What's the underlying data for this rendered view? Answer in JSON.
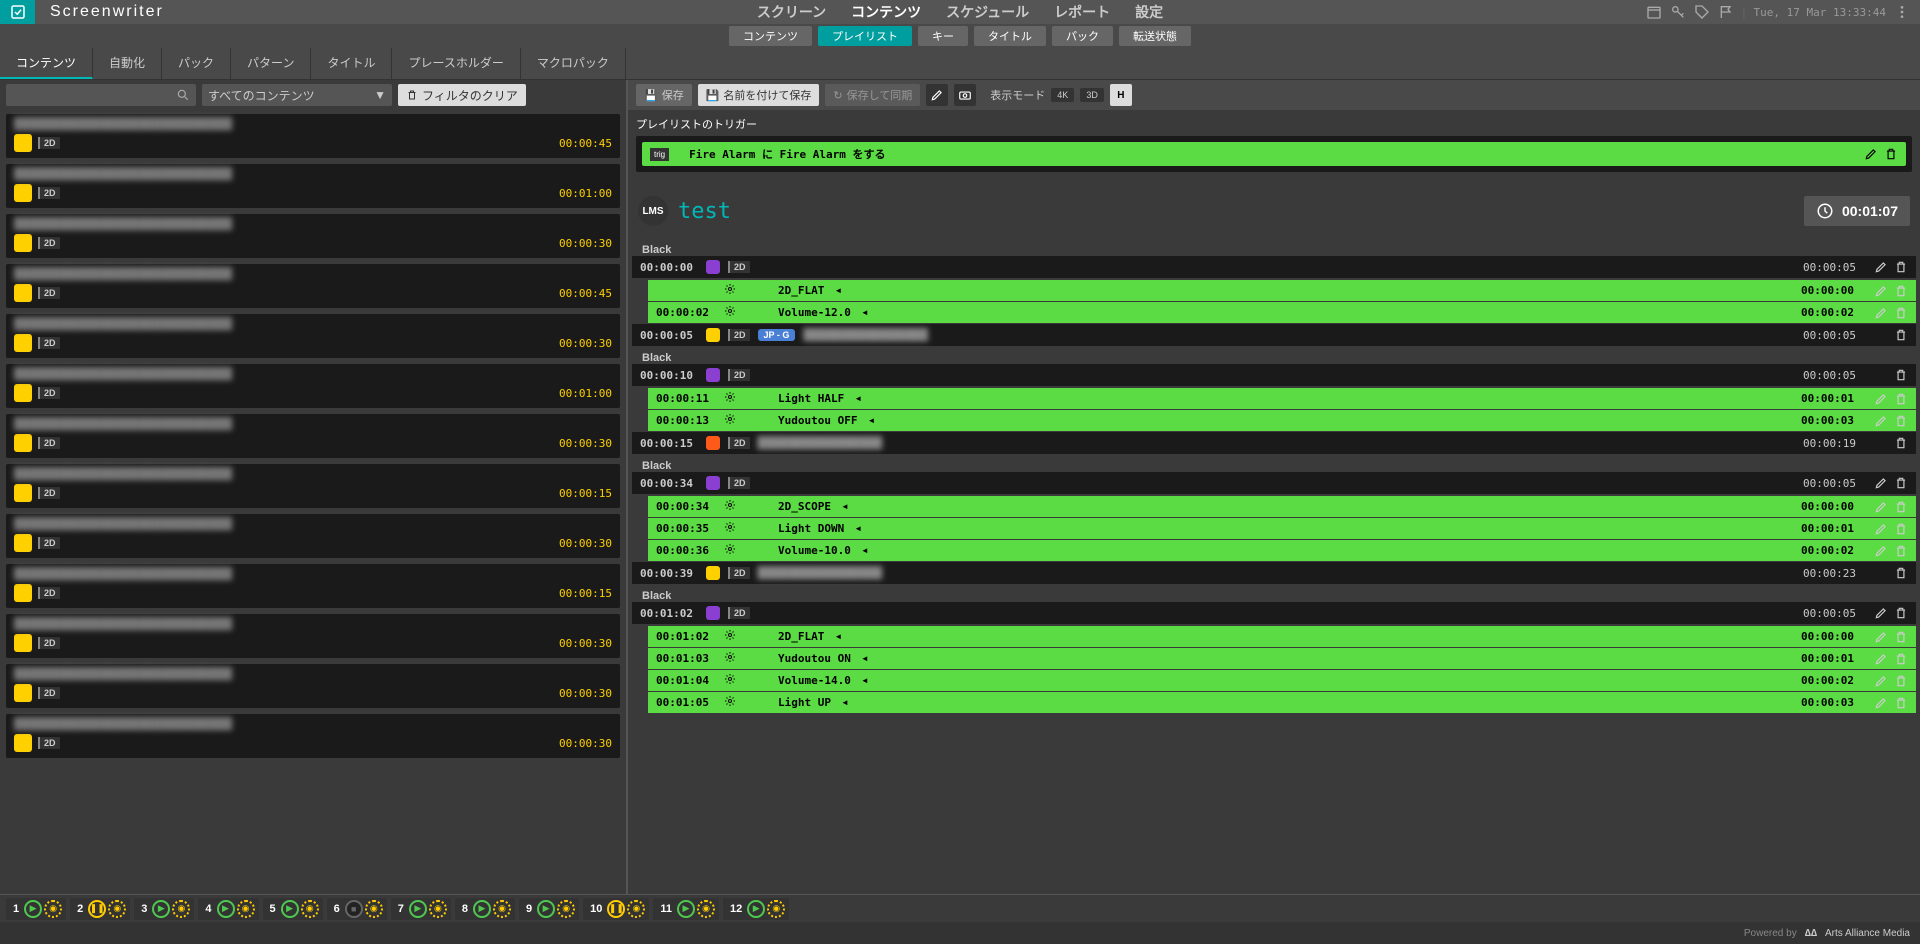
{
  "app": {
    "title": "Screenwriter"
  },
  "datetime": "Tue, 17 Mar 13:33:44",
  "top_nav": {
    "items": [
      "スクリーン",
      "コンテンツ",
      "スケジュール",
      "レポート",
      "設定"
    ],
    "active": 1
  },
  "sub_nav": {
    "items": [
      "コンテンツ",
      "プレイリスト",
      "キー",
      "タイトル",
      "パック",
      "転送状態"
    ],
    "active": 1
  },
  "left_tabs": {
    "items": [
      "コンテンツ",
      "自動化",
      "パック",
      "パターン",
      "タイトル",
      "プレースホルダー",
      "マクロパック"
    ],
    "active": 0
  },
  "filter": {
    "search_placeholder": "",
    "dropdown": "すべてのコンテンツ",
    "clear": "フィルタのクリア"
  },
  "content_list": [
    {
      "badge": "2D",
      "duration": "00:00:45"
    },
    {
      "badge": "2D",
      "duration": "00:01:00"
    },
    {
      "badge": "2D",
      "duration": "00:00:30"
    },
    {
      "badge": "2D",
      "duration": "00:00:45"
    },
    {
      "badge": "2D",
      "duration": "00:00:30"
    },
    {
      "badge": "2D",
      "duration": "00:01:00"
    },
    {
      "badge": "2D",
      "duration": "00:00:30"
    },
    {
      "badge": "2D",
      "duration": "00:00:15"
    },
    {
      "badge": "2D",
      "duration": "00:00:30"
    },
    {
      "badge": "2D",
      "duration": "00:00:15"
    },
    {
      "badge": "2D",
      "duration": "00:00:30"
    },
    {
      "badge": "2D",
      "duration": "00:00:30"
    },
    {
      "badge": "2D",
      "duration": "00:00:30"
    }
  ],
  "toolbar": {
    "save": "保存",
    "save_as": "名前を付けて保存",
    "save_sync": "保存して同期",
    "display_mode": "表示モード",
    "pill_4k": "4K",
    "pill_3d": "3D"
  },
  "trigger": {
    "header": "プレイリストのトリガー",
    "badge": "trig",
    "text": "Fire Alarm に Fire Alarm をする"
  },
  "playlist": {
    "badge": "LMS",
    "title": "test",
    "total": "00:01:07",
    "rows": [
      {
        "type": "label",
        "text": "Black"
      },
      {
        "type": "clip",
        "time": "00:00:00",
        "box": "purple",
        "tag": "2D",
        "dur": "00:00:05",
        "edit": true
      },
      {
        "type": "cue",
        "time": "",
        "label": "2D_FLAT",
        "dur": "00:00:00"
      },
      {
        "type": "cue",
        "time": "00:00:02",
        "label": "Volume-12.0",
        "dur": "00:00:02"
      },
      {
        "type": "clip",
        "time": "00:00:05",
        "box": "yellow",
        "tag": "2D",
        "jp": "JP - G",
        "dur": "00:00:05",
        "blurred": true
      },
      {
        "type": "label",
        "text": "Black"
      },
      {
        "type": "clip",
        "time": "00:00:10",
        "box": "purple",
        "tag": "2D",
        "dur": "00:00:05"
      },
      {
        "type": "cue",
        "time": "00:00:11",
        "label": "Light HALF",
        "dur": "00:00:01"
      },
      {
        "type": "cue",
        "time": "00:00:13",
        "label": "Yudoutou OFF",
        "dur": "00:00:03"
      },
      {
        "type": "clip",
        "time": "00:00:15",
        "box": "orange",
        "tag": "2D",
        "dur": "00:00:19",
        "blurred": true
      },
      {
        "type": "label",
        "text": "Black"
      },
      {
        "type": "clip",
        "time": "00:00:34",
        "box": "purple",
        "tag": "2D",
        "dur": "00:00:05",
        "edit": true
      },
      {
        "type": "cue",
        "time": "00:00:34",
        "label": "2D_SCOPE",
        "dur": "00:00:00"
      },
      {
        "type": "cue",
        "time": "00:00:35",
        "label": "Light DOWN",
        "dur": "00:00:01"
      },
      {
        "type": "cue",
        "time": "00:00:36",
        "label": "Volume-10.0",
        "dur": "00:00:02"
      },
      {
        "type": "clip",
        "time": "00:00:39",
        "box": "yellow",
        "tag": "2D",
        "dur": "00:00:23",
        "blurred": true
      },
      {
        "type": "label",
        "text": "Black"
      },
      {
        "type": "clip",
        "time": "00:01:02",
        "box": "purple",
        "tag": "2D",
        "dur": "00:00:05",
        "edit": true
      },
      {
        "type": "cue",
        "time": "00:01:02",
        "label": "2D_FLAT",
        "dur": "00:00:00"
      },
      {
        "type": "cue",
        "time": "00:01:03",
        "label": "Yudoutou ON",
        "dur": "00:00:01"
      },
      {
        "type": "cue",
        "time": "00:01:04",
        "label": "Volume-14.0",
        "dur": "00:00:02"
      },
      {
        "type": "cue",
        "time": "00:01:05",
        "label": "Light UP",
        "dur": "00:00:03"
      }
    ]
  },
  "players": [
    {
      "n": "1",
      "state": "play"
    },
    {
      "n": "2",
      "state": "pause"
    },
    {
      "n": "3",
      "state": "play"
    },
    {
      "n": "4",
      "state": "play"
    },
    {
      "n": "5",
      "state": "play"
    },
    {
      "n": "6",
      "state": "stop"
    },
    {
      "n": "7",
      "state": "play"
    },
    {
      "n": "8",
      "state": "play"
    },
    {
      "n": "9",
      "state": "play"
    },
    {
      "n": "10",
      "state": "pause"
    },
    {
      "n": "11",
      "state": "play"
    },
    {
      "n": "12",
      "state": "play"
    }
  ],
  "footer": {
    "powered": "Powered by",
    "company": "Arts Alliance Media"
  }
}
